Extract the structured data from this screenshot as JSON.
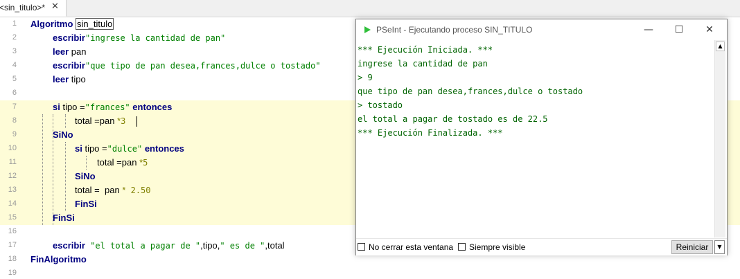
{
  "tab": {
    "label": "<sin_titulo>*",
    "close_glyph": "✕"
  },
  "code": {
    "line_numbers": [
      "1",
      "2",
      "3",
      "4",
      "5",
      "6",
      "7",
      "8",
      "9",
      "10",
      "11",
      "12",
      "13",
      "14",
      "15",
      "16",
      "17",
      "18",
      "19"
    ],
    "l1": {
      "kw": "Algoritmo",
      "name": "sin_titulo"
    },
    "l2": {
      "kw": "escribir",
      "str": "\"ingrese la cantidad de pan\""
    },
    "l3": {
      "kw": "leer",
      "id": " pan"
    },
    "l4": {
      "kw": "escribir",
      "str": "\"que tipo de pan desea,frances,dulce o tostado\""
    },
    "l5": {
      "kw": "leer",
      "id": " tipo"
    },
    "l7": {
      "kw": "si",
      "id": " tipo =",
      "str": "\"frances\"",
      "kw2": " entonces"
    },
    "l8": {
      "id": "total =pan ",
      "op": "*",
      "num": "3"
    },
    "l9": {
      "kw": "SiNo"
    },
    "l10": {
      "kw": "si",
      "id": " tipo =",
      "str": "\"dulce\"",
      "kw2": " entonces"
    },
    "l11": {
      "id": "total =pan ",
      "op": "*",
      "num": "5"
    },
    "l12": {
      "kw": "SiNo"
    },
    "l13": {
      "id": "total =  pan ",
      "op": "*",
      "num": " 2.50"
    },
    "l14": {
      "kw": "FinSi"
    },
    "l15": {
      "kw": "FinSi"
    },
    "l17": {
      "kw": "escribir",
      "str1": " \"el total a pagar de \"",
      "id1": ",tipo,",
      "str2": "\" es de \"",
      "id2": ",total"
    },
    "l18": {
      "kw": "FinAlgoritmo"
    }
  },
  "console_window": {
    "title": "PSeInt - Ejecutando proceso SIN_TITULO",
    "minimize_glyph": "—",
    "maximize_glyph": "☐",
    "close_glyph": "✕",
    "lines": [
      "*** Ejecución Iniciada. ***",
      "ingrese la cantidad de pan",
      "> 9",
      "que tipo de pan desea,frances,dulce o tostado",
      "> tostado",
      "el total a pagar de tostado es de 22.5",
      "*** Ejecución Finalizada. ***"
    ],
    "checkbox_no_cerrar": "No cerrar esta ventana",
    "checkbox_siempre_visible": "Siempre visible",
    "reiniciar_label": "Reiniciar",
    "scroll_up_glyph": "▲",
    "dropdown_glyph": "▼"
  }
}
